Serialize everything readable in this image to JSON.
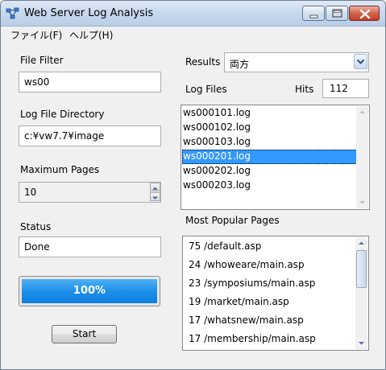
{
  "window": {
    "title": "Web Server Log Analysis"
  },
  "menu": [
    {
      "label": "ファイル(F)"
    },
    {
      "label": "ヘルプ(H)"
    }
  ],
  "left": {
    "file_filter_label": "File Filter",
    "file_filter_value": "ws00",
    "log_dir_label": "Log File Directory",
    "log_dir_value": "c:¥vw7.7¥image",
    "max_pages_label": "Maximum Pages",
    "max_pages_value": "10",
    "status_label": "Status",
    "status_value": "Done",
    "progress_text": "100%",
    "progress_fraction": 1.0,
    "start_label": "Start"
  },
  "right": {
    "results_label": "Results",
    "results_value": "両方",
    "log_files_label": "Log Files",
    "hits_label": "Hits",
    "hits_value": "112",
    "log_files": [
      "ws000101.log",
      "ws000102.log",
      "ws000103.log",
      "ws000201.log",
      "ws000202.log",
      "ws000203.log"
    ],
    "selected_log_index": 3,
    "popular_label": "Most Popular Pages",
    "popular_pages": [
      "75 /default.asp",
      "24 /whoweare/main.asp",
      "23 /symposiums/main.asp",
      "19 /market/main.asp",
      "17 /whatsnew/main.asp",
      "17 /membership/main.asp"
    ]
  },
  "colors": {
    "selection": "#3399ff",
    "progress": "#1d8fe8"
  }
}
